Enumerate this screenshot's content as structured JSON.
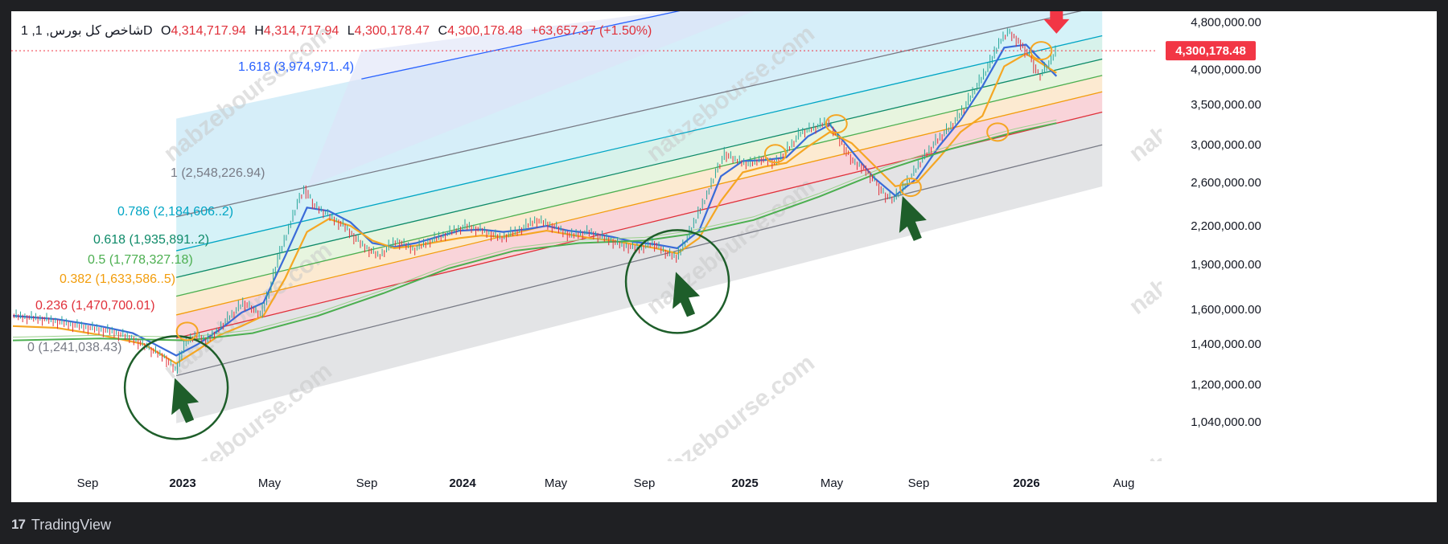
{
  "header": {
    "symbol": "1 ,شاخص کل بورس, 1D",
    "o_label": "O",
    "o_value": "4,314,717.94",
    "h_label": "H",
    "h_value": "4,314,717.94",
    "l_label": "L",
    "l_value": "4,300,178.47",
    "c_label": "C",
    "c_value": "4,300,178.48",
    "change": "+63,657.37 (+1.50%)"
  },
  "branding": {
    "name": "TradingView",
    "watermark": "nabzebourse.com"
  },
  "colors": {
    "up": "#26a69a",
    "down": "#e0303a",
    "ma_fast": "#3a6bd8",
    "ma_mid": "#f5a623",
    "ma_slow": "#4caf50",
    "price_tag": "#f23645",
    "signal": "#1e5e2a"
  },
  "chart_data": {
    "type": "line",
    "scale": "log",
    "ylim": [
      900000,
      5000000
    ],
    "y_ticks": [
      {
        "value": 4800000,
        "label": "4,800,000.00"
      },
      {
        "value": 4000000,
        "label": "4,000,000.00"
      },
      {
        "value": 3500000,
        "label": "3,500,000.00"
      },
      {
        "value": 3000000,
        "label": "3,000,000.00"
      },
      {
        "value": 2600000,
        "label": "2,600,000.00"
      },
      {
        "value": 2200000,
        "label": "2,200,000.00"
      },
      {
        "value": 1900000,
        "label": "1,900,000.00"
      },
      {
        "value": 1600000,
        "label": "1,600,000.00"
      },
      {
        "value": 1400000,
        "label": "1,400,000.00"
      },
      {
        "value": 1200000,
        "label": "1,200,000.00"
      },
      {
        "value": 1040000,
        "label": "1,040,000.00"
      }
    ],
    "x_ticks": [
      {
        "label": "Sep",
        "bold": false
      },
      {
        "label": "2023",
        "bold": true
      },
      {
        "label": "May",
        "bold": false
      },
      {
        "label": "Sep",
        "bold": false
      },
      {
        "label": "2024",
        "bold": true
      },
      {
        "label": "May",
        "bold": false
      },
      {
        "label": "Sep",
        "bold": false
      },
      {
        "label": "2025",
        "bold": true
      },
      {
        "label": "May",
        "bold": false
      },
      {
        "label": "Sep",
        "bold": false
      },
      {
        "label": "2026",
        "bold": true
      },
      {
        "label": "Aug",
        "bold": false
      }
    ],
    "last_price": {
      "value": 4300178.48,
      "label": "4,300,178.48"
    },
    "fib_levels": [
      {
        "ratio": 0,
        "label": "0 (1,241,038.43)",
        "color": "#787b86"
      },
      {
        "ratio": 0.236,
        "label": "0.236 (1,470,700.01)",
        "color": "#e0303a"
      },
      {
        "ratio": 0.382,
        "label": "0.382 (1,633,586..5)",
        "color": "#f29d0c"
      },
      {
        "ratio": 0.5,
        "label": "0.5 (1,778,327.18)",
        "color": "#4caf50"
      },
      {
        "ratio": 0.618,
        "label": "0.618 (1,935,891..2)",
        "color": "#0d8a68"
      },
      {
        "ratio": 0.786,
        "label": "0.786 (2,184,606..2)",
        "color": "#00a5c4"
      },
      {
        "ratio": 1,
        "label": "1 (2,548,226.94)",
        "color": "#787b86"
      },
      {
        "ratio": 1.618,
        "label": "1.618 (3,974,971..4)",
        "color": "#2962ff"
      }
    ],
    "series": [
      {
        "type": "candles",
        "points": [
          [
            0,
            1560000
          ],
          [
            15,
            1540000
          ],
          [
            30,
            1500000
          ],
          [
            45,
            1470000
          ],
          [
            55,
            1430000
          ],
          [
            62,
            1380000
          ],
          [
            70,
            1330000
          ],
          [
            75,
            1260000
          ],
          [
            79,
            1400000
          ],
          [
            84,
            1450000
          ],
          [
            89,
            1420000
          ],
          [
            94,
            1480000
          ],
          [
            100,
            1560000
          ],
          [
            106,
            1640000
          ],
          [
            110,
            1600000
          ],
          [
            114,
            1560000
          ],
          [
            118,
            1720000
          ],
          [
            122,
            1950000
          ],
          [
            127,
            2200000
          ],
          [
            131,
            2420000
          ],
          [
            134,
            2548000
          ],
          [
            138,
            2380000
          ],
          [
            144,
            2300000
          ],
          [
            152,
            2200000
          ],
          [
            160,
            2050000
          ],
          [
            168,
            1960000
          ],
          [
            176,
            2080000
          ],
          [
            184,
            2010000
          ],
          [
            192,
            2080000
          ],
          [
            200,
            2140000
          ],
          [
            208,
            2200000
          ],
          [
            216,
            2160000
          ],
          [
            224,
            2100000
          ],
          [
            232,
            2160000
          ],
          [
            240,
            2250000
          ],
          [
            248,
            2200000
          ],
          [
            256,
            2120000
          ],
          [
            264,
            2150000
          ],
          [
            272,
            2100000
          ],
          [
            280,
            2040000
          ],
          [
            288,
            2020000
          ],
          [
            294,
            2060000
          ],
          [
            300,
            1980000
          ],
          [
            305,
            1950000
          ],
          [
            309,
            2080000
          ],
          [
            314,
            2280000
          ],
          [
            319,
            2500000
          ],
          [
            323,
            2720000
          ],
          [
            327,
            2900000
          ],
          [
            332,
            2820000
          ],
          [
            338,
            2780000
          ],
          [
            344,
            2850000
          ],
          [
            350,
            2800000
          ],
          [
            356,
            2960000
          ],
          [
            362,
            3150000
          ],
          [
            368,
            3200000
          ],
          [
            374,
            3280000
          ],
          [
            378,
            3100000
          ],
          [
            382,
            2950000
          ],
          [
            386,
            2800000
          ],
          [
            391,
            2750000
          ],
          [
            396,
            2600000
          ],
          [
            400,
            2480000
          ],
          [
            404,
            2430000
          ],
          [
            408,
            2520000
          ],
          [
            412,
            2650000
          ],
          [
            418,
            2860000
          ],
          [
            424,
            3050000
          ],
          [
            430,
            3200000
          ],
          [
            436,
            3420000
          ],
          [
            442,
            3720000
          ],
          [
            448,
            4050000
          ],
          [
            453,
            4450000
          ],
          [
            457,
            4620000
          ],
          [
            462,
            4450000
          ],
          [
            467,
            4200000
          ],
          [
            471,
            3900000
          ],
          [
            475,
            4050000
          ],
          [
            479,
            4300178
          ]
        ]
      },
      {
        "name": "",
        "color": "#3a6bd8",
        "points": [
          [
            0,
            1560000
          ],
          [
            20,
            1540000
          ],
          [
            40,
            1500000
          ],
          [
            55,
            1460000
          ],
          [
            65,
            1400000
          ],
          [
            75,
            1340000
          ],
          [
            85,
            1400000
          ],
          [
            95,
            1480000
          ],
          [
            105,
            1580000
          ],
          [
            115,
            1640000
          ],
          [
            125,
            1960000
          ],
          [
            135,
            2360000
          ],
          [
            145,
            2330000
          ],
          [
            155,
            2230000
          ],
          [
            165,
            2060000
          ],
          [
            175,
            2030000
          ],
          [
            185,
            2060000
          ],
          [
            195,
            2110000
          ],
          [
            205,
            2160000
          ],
          [
            215,
            2170000
          ],
          [
            225,
            2150000
          ],
          [
            235,
            2170000
          ],
          [
            245,
            2200000
          ],
          [
            255,
            2160000
          ],
          [
            265,
            2140000
          ],
          [
            275,
            2110000
          ],
          [
            285,
            2070000
          ],
          [
            295,
            2050000
          ],
          [
            305,
            2020000
          ],
          [
            315,
            2160000
          ],
          [
            325,
            2660000
          ],
          [
            335,
            2820000
          ],
          [
            345,
            2830000
          ],
          [
            355,
            2860000
          ],
          [
            365,
            3100000
          ],
          [
            375,
            3240000
          ],
          [
            385,
            2930000
          ],
          [
            395,
            2650000
          ],
          [
            405,
            2470000
          ],
          [
            415,
            2640000
          ],
          [
            425,
            2980000
          ],
          [
            435,
            3300000
          ],
          [
            445,
            3750000
          ],
          [
            455,
            4350000
          ],
          [
            465,
            4400000
          ],
          [
            479,
            3900000
          ]
        ]
      },
      {
        "name": "",
        "color": "#f5a623",
        "points": [
          [
            0,
            1500000
          ],
          [
            20,
            1490000
          ],
          [
            40,
            1450000
          ],
          [
            60,
            1400000
          ],
          [
            75,
            1300000
          ],
          [
            85,
            1370000
          ],
          [
            95,
            1450000
          ],
          [
            105,
            1500000
          ],
          [
            115,
            1560000
          ],
          [
            125,
            1800000
          ],
          [
            135,
            2150000
          ],
          [
            145,
            2260000
          ],
          [
            155,
            2200000
          ],
          [
            165,
            2080000
          ],
          [
            175,
            2020000
          ],
          [
            185,
            2040000
          ],
          [
            195,
            2070000
          ],
          [
            205,
            2100000
          ],
          [
            215,
            2120000
          ],
          [
            225,
            2110000
          ],
          [
            235,
            2130000
          ],
          [
            245,
            2160000
          ],
          [
            255,
            2130000
          ],
          [
            265,
            2100000
          ],
          [
            275,
            2080000
          ],
          [
            285,
            2050000
          ],
          [
            295,
            2020000
          ],
          [
            305,
            1980000
          ],
          [
            315,
            2100000
          ],
          [
            325,
            2420000
          ],
          [
            335,
            2700000
          ],
          [
            345,
            2760000
          ],
          [
            355,
            2800000
          ],
          [
            365,
            2980000
          ],
          [
            375,
            3150000
          ],
          [
            385,
            3020000
          ],
          [
            395,
            2780000
          ],
          [
            405,
            2560000
          ],
          [
            415,
            2600000
          ],
          [
            425,
            2850000
          ],
          [
            435,
            3150000
          ],
          [
            445,
            3350000
          ],
          [
            455,
            4050000
          ],
          [
            465,
            4250000
          ],
          [
            479,
            3950000
          ]
        ]
      },
      {
        "name": "",
        "color": "#4caf50",
        "points": [
          [
            0,
            1420000
          ],
          [
            40,
            1430000
          ],
          [
            80,
            1420000
          ],
          [
            110,
            1460000
          ],
          [
            140,
            1560000
          ],
          [
            170,
            1700000
          ],
          [
            200,
            1870000
          ],
          [
            230,
            2000000
          ],
          [
            260,
            2060000
          ],
          [
            290,
            2080000
          ],
          [
            310,
            2130000
          ],
          [
            340,
            2250000
          ],
          [
            370,
            2460000
          ],
          [
            400,
            2720000
          ],
          [
            430,
            2950000
          ],
          [
            460,
            3150000
          ],
          [
            479,
            3260000
          ]
        ]
      }
    ],
    "channel_upper": {
      "start": [
        134,
        2548000
      ],
      "end": [
        500,
        5100000
      ]
    },
    "channel_lower": {
      "start": [
        75,
        1241000
      ],
      "end": [
        500,
        3000000
      ]
    },
    "signals": [
      {
        "type": "circle-arrow-up",
        "at": [
          75,
          1300000
        ]
      },
      {
        "type": "circle-arrow-up",
        "at": [
          305,
          1950000
        ]
      },
      {
        "type": "arrow-up",
        "at": [
          412,
          2320000
        ]
      },
      {
        "type": "arrow-down",
        "at": [
          479,
          4850000
        ]
      }
    ]
  }
}
